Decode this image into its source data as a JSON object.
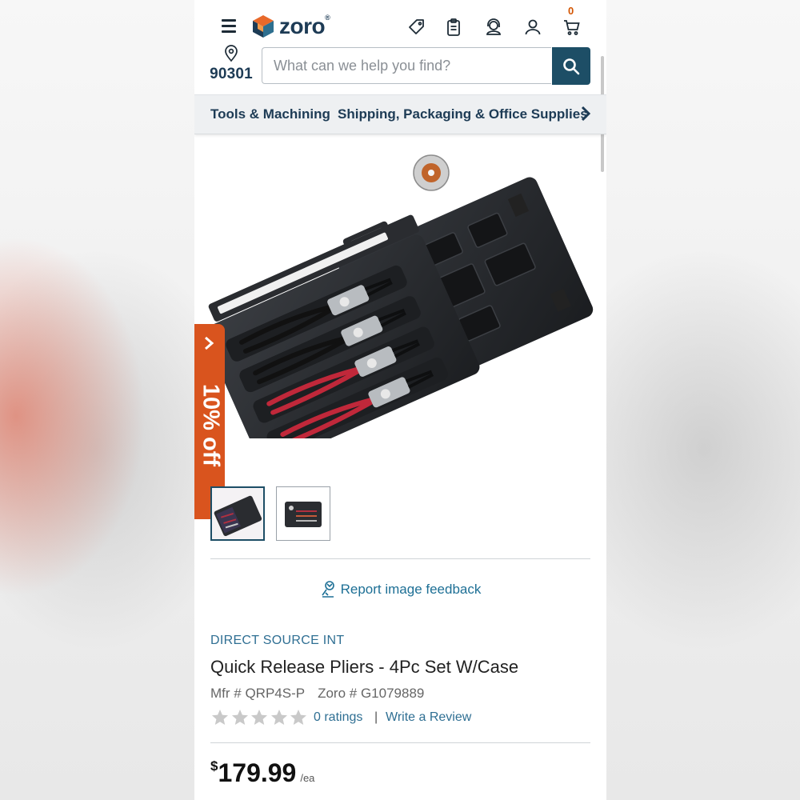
{
  "header": {
    "logo_text": "zoro",
    "logo_mark": "®",
    "cart_count": "0",
    "icons": [
      "menu-icon",
      "tag-icon",
      "clipboard-icon",
      "support-icon",
      "account-icon",
      "cart-icon"
    ]
  },
  "location": {
    "zip": "90301",
    "icon": "location-pin-icon"
  },
  "search": {
    "placeholder": "What can we help you find?",
    "value": ""
  },
  "categories": [
    "Tools & Machining",
    "Shipping, Packaging & Office Supplies"
  ],
  "promo": {
    "label": "10% off"
  },
  "gallery": {
    "thumbnail_count": 2,
    "selected_index": 0
  },
  "feedback": {
    "label": "Report image feedback"
  },
  "product": {
    "brand": "DIRECT SOURCE INT",
    "title": "Quick Release Pliers - 4Pc Set W/Case",
    "mfr": "Mfr # QRP4S-P",
    "zoro_number": "Zoro # G1079889",
    "rating_stars": 0,
    "ratings_label": "0 ratings",
    "separator": "|",
    "review_link": "Write a Review",
    "price_currency": "$",
    "price_amount": "179.99",
    "price_unit": "/ea"
  },
  "colors": {
    "brand_navy": "#1d3b55",
    "search_button": "#1d4e66",
    "promo_orange": "#d9541e",
    "link_blue": "#2f6f93"
  }
}
